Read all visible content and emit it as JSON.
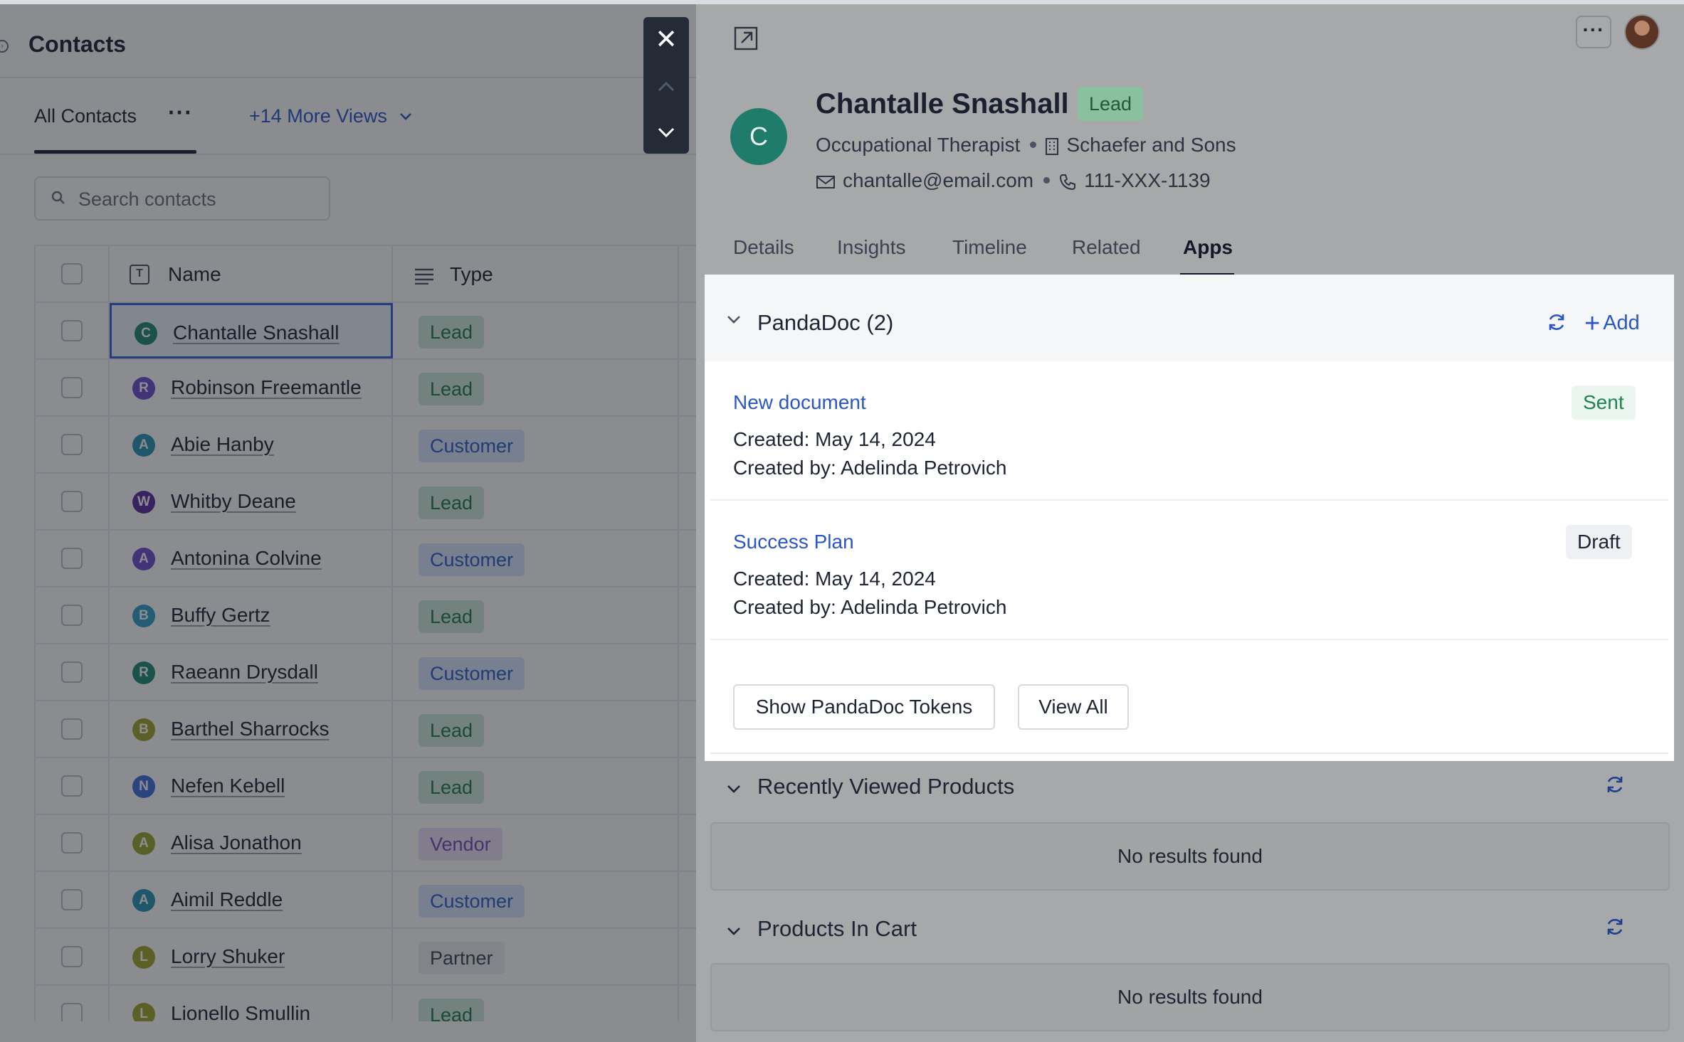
{
  "left_panel": {
    "title": "Contacts",
    "views": {
      "active_view": "All Contacts",
      "more_views": "+14 More Views"
    },
    "search": {
      "placeholder": "Search contacts"
    },
    "columns": {
      "name": "Name",
      "type": "Type"
    },
    "rows": [
      {
        "initial": "C",
        "name": "Chantalle Snashall",
        "type": "Lead",
        "avatar_color": "#1f8a74"
      },
      {
        "initial": "R",
        "name": "Robinson Freemantle",
        "type": "Lead",
        "avatar_color": "#6c4cc8"
      },
      {
        "initial": "A",
        "name": "Abie Hanby",
        "type": "Customer",
        "avatar_color": "#2594b0"
      },
      {
        "initial": "W",
        "name": "Whitby Deane",
        "type": "Lead",
        "avatar_color": "#5a2c9e"
      },
      {
        "initial": "A",
        "name": "Antonina Colvine",
        "type": "Customer",
        "avatar_color": "#6c4cc8"
      },
      {
        "initial": "B",
        "name": "Buffy Gertz",
        "type": "Lead",
        "avatar_color": "#2f9fc8"
      },
      {
        "initial": "R",
        "name": "Raeann Drysdall",
        "type": "Customer",
        "avatar_color": "#1f8a74"
      },
      {
        "initial": "B",
        "name": "Barthel Sharrocks",
        "type": "Lead",
        "avatar_color": "#a3a62a"
      },
      {
        "initial": "N",
        "name": "Nefen Kebell",
        "type": "Lead",
        "avatar_color": "#3f6ed8"
      },
      {
        "initial": "A",
        "name": "Alisa Jonathon",
        "type": "Vendor",
        "avatar_color": "#9aa52c"
      },
      {
        "initial": "A",
        "name": "Aimil Reddle",
        "type": "Customer",
        "avatar_color": "#2594b0"
      },
      {
        "initial": "L",
        "name": "Lorry Shuker",
        "type": "Partner",
        "avatar_color": "#a3a62a"
      },
      {
        "initial": "L",
        "name": "Lionello Smullin",
        "type": "Lead",
        "avatar_color": "#a3a62a"
      }
    ]
  },
  "record_nav": {
    "close_icon": "close-icon",
    "prev_icon": "chevron-up-icon",
    "next_icon": "chevron-down-icon"
  },
  "detail": {
    "avatar_initial": "C",
    "name": "Chantalle Snashall",
    "type_badge": "Lead",
    "job_title": "Occupational Therapist",
    "company": "Schaefer and Sons",
    "email": "chantalle@email.com",
    "phone": "111-XXX-1139",
    "tabs": [
      "Details",
      "Insights",
      "Timeline",
      "Related",
      "Apps"
    ],
    "active_tab": "Apps"
  },
  "pandadoc": {
    "title": "PandaDoc (2)",
    "add_label": "Add",
    "documents": [
      {
        "title": "New document",
        "created": "Created: May 14, 2024",
        "created_by": "Created by: Adelinda Petrovich",
        "status": "Sent"
      },
      {
        "title": "Success Plan",
        "created": "Created: May 14, 2024",
        "created_by": "Created by: Adelinda Petrovich",
        "status": "Draft"
      }
    ],
    "show_tokens_label": "Show PandaDoc Tokens",
    "view_all_label": "View All"
  },
  "recently_viewed": {
    "title": "Recently Viewed Products",
    "empty": "No results found"
  },
  "products_in_cart": {
    "title": "Products In Cart",
    "empty": "No results found"
  },
  "colors": {
    "accent_blue": "#2b56c9",
    "lead_green": "#1f7a4a",
    "overlay": "rgba(22,26,34,0.5)"
  }
}
